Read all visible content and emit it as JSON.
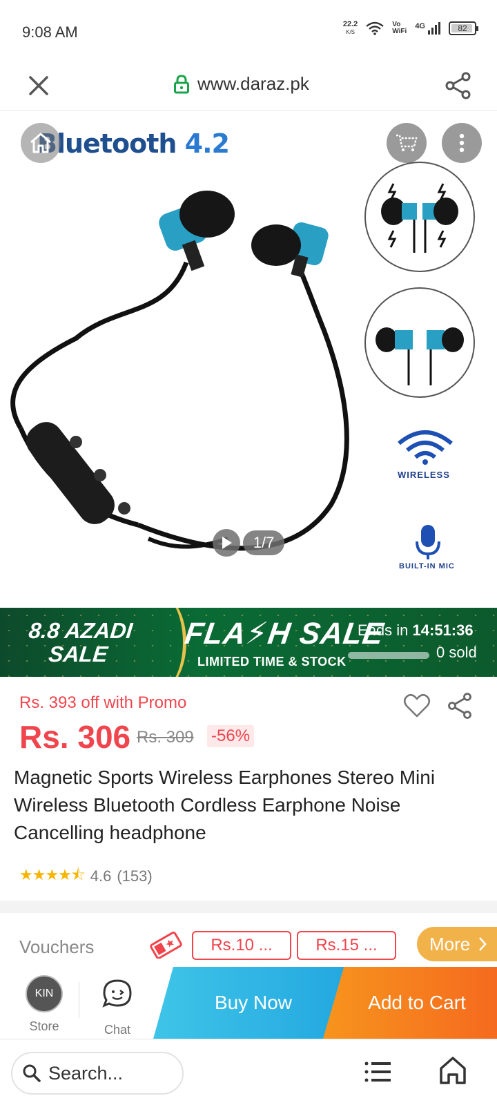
{
  "status": {
    "time": "9:08 AM",
    "speed_value": "22.2",
    "speed_unit": "K/S",
    "vowifi_top": "Vo",
    "vowifi_bottom": "WiFi",
    "network": "4G",
    "battery": "82",
    "battery_level": 0.82
  },
  "browser": {
    "url": "www.daraz.pk"
  },
  "product_image": {
    "headline_word": "Bluetooth",
    "headline_version": "4.2",
    "feature_wireless": "WIRELESS",
    "feature_mic": "BUILT-IN MIC",
    "counter": "1/7"
  },
  "flash_sale": {
    "campaign_line1": "8.8 AZADI",
    "campaign_line2": "SALE",
    "title": "FLA⚡H SALE",
    "subtitle": "LIMITED TIME & STOCK",
    "ends_label": "Ends in",
    "ends_time": "14:51:36",
    "sold": "0 sold",
    "sold_fraction": 0
  },
  "price": {
    "promo": "Rs. 393 off with Promo",
    "current": "Rs. 306",
    "original": "Rs. 309",
    "discount": "-56%"
  },
  "product": {
    "title": "Magnetic Sports Wireless Earphones Stereo Mini Wireless Bluetooth Cordless Earphone Noise Cancelling headphone",
    "stars": "★★★★⯪",
    "rating": "4.6",
    "reviews": "(153)"
  },
  "vouchers": {
    "label": "Vouchers",
    "items": [
      "Rs.10 ...",
      "Rs.15 ..."
    ],
    "more": "More"
  },
  "actions": {
    "store": "Store",
    "store_logo": "KIN",
    "chat": "Chat",
    "buy_now": "Buy Now",
    "add_to_cart": "Add to Cart"
  },
  "bottom_nav": {
    "search_placeholder": "Search..."
  },
  "colors": {
    "accent_red": "#f0454d",
    "buy_now": "#22a7e0",
    "add_to_cart": "#f56a1f",
    "flash_green": "#0a6b35",
    "secure_green": "#1aa34a"
  }
}
